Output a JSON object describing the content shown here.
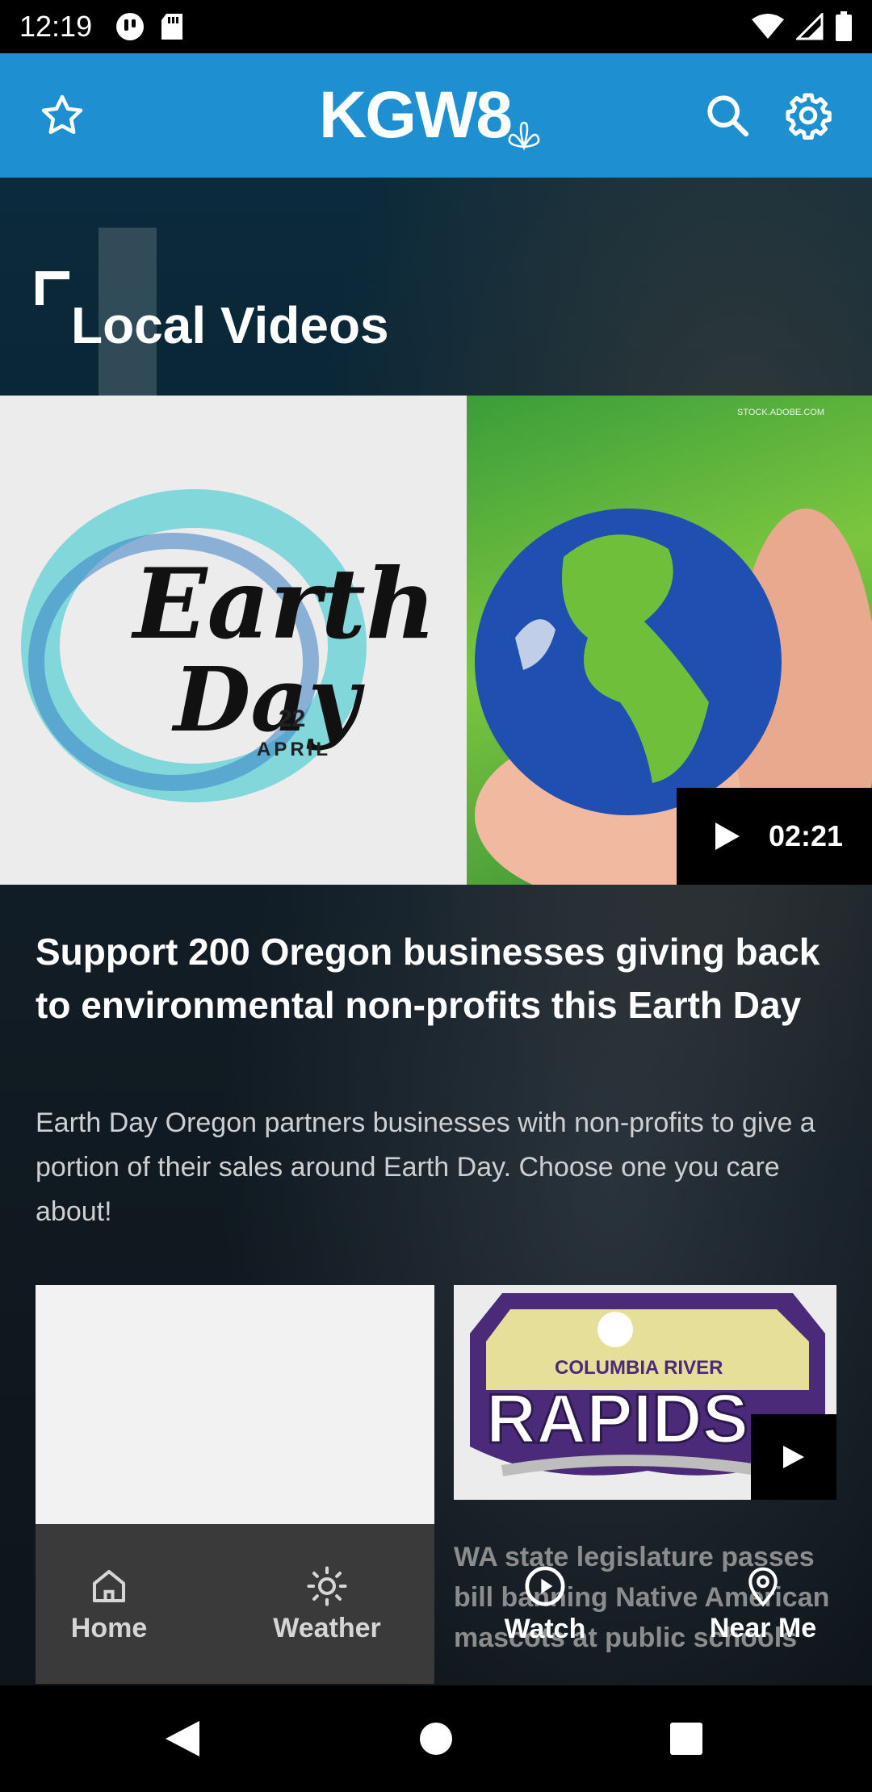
{
  "status_bar": {
    "time": "12:19"
  },
  "header": {
    "logo_text": "KGW8"
  },
  "section": {
    "title": "Local Videos"
  },
  "feature": {
    "image_watermark": "STOCK.ADOBE.COM",
    "duration": "02:21",
    "headline": "Support 200 Oregon businesses giving back to environmental non-profits this Earth Day",
    "summary": "Earth Day Oregon partners businesses with non-profits to give a portion of their sales around Earth Day. Choose one you care about!",
    "earthday_title_1": "Earth",
    "earthday_title_2": "Day",
    "earthday_date_num": "22",
    "earthday_date_month": "APRIL"
  },
  "cards": {
    "right": {
      "title": "WA state legislature passes bill banning Native American mascots at public schools",
      "logo_top": "COLUMBIA RIVER",
      "logo_main": "RAPIDS"
    }
  },
  "bottom_nav": {
    "items": [
      {
        "label": "Home",
        "icon": "home-icon"
      },
      {
        "label": "Weather",
        "icon": "sun-icon"
      },
      {
        "label": "Watch",
        "icon": "play-circle-icon"
      },
      {
        "label": "Near Me",
        "icon": "location-pin-icon"
      }
    ]
  },
  "colors": {
    "header_blue": "#1e90d1",
    "active_nav_bg": "#3a3a3a"
  }
}
